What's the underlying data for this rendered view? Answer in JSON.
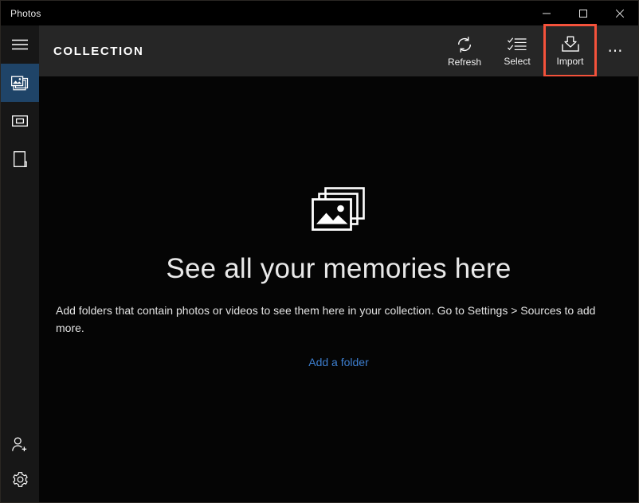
{
  "window": {
    "app_title": "Photos",
    "controls": [
      {
        "name": "minimize",
        "label": "Minimize"
      },
      {
        "name": "maximize",
        "label": "Maximize"
      },
      {
        "name": "close",
        "label": "Close"
      }
    ]
  },
  "sidebar": {
    "menu": {
      "label": "Menu",
      "icon": "hamburger-icon"
    },
    "items": [
      {
        "label": "Collection",
        "icon": "photos-stack-icon",
        "selected": true
      },
      {
        "label": "Albums",
        "icon": "album-icon",
        "selected": false
      },
      {
        "label": "Folders",
        "icon": "folder-book-icon",
        "selected": false
      }
    ],
    "bottom_items": [
      {
        "label": "People",
        "icon": "add-person-icon"
      },
      {
        "label": "Settings",
        "icon": "gear-icon"
      }
    ]
  },
  "commandbar": {
    "title": "COLLECTION",
    "buttons": [
      {
        "label": "Refresh",
        "icon": "refresh-icon",
        "highlighted": false
      },
      {
        "label": "Select",
        "icon": "select-checklist-icon",
        "highlighted": false
      },
      {
        "label": "Import",
        "icon": "import-download-icon",
        "highlighted": true
      }
    ],
    "more": {
      "label": "See more",
      "icon": "ellipsis-icon"
    }
  },
  "content": {
    "icon": "photos-stack-large-icon",
    "heading": "See all your memories here",
    "body": "Add folders that contain photos or videos to see them here in your collection. Go to Settings > Sources to add more.",
    "link": "Add a folder"
  },
  "colors": {
    "accent_selected": "#1f4468",
    "link": "#3d7fd0",
    "highlight_outline": "#f4523b",
    "titlebar_bg": "#000000",
    "commandbar_bg": "#262626",
    "sidebar_bg": "#171717",
    "content_bg": "#050505"
  }
}
